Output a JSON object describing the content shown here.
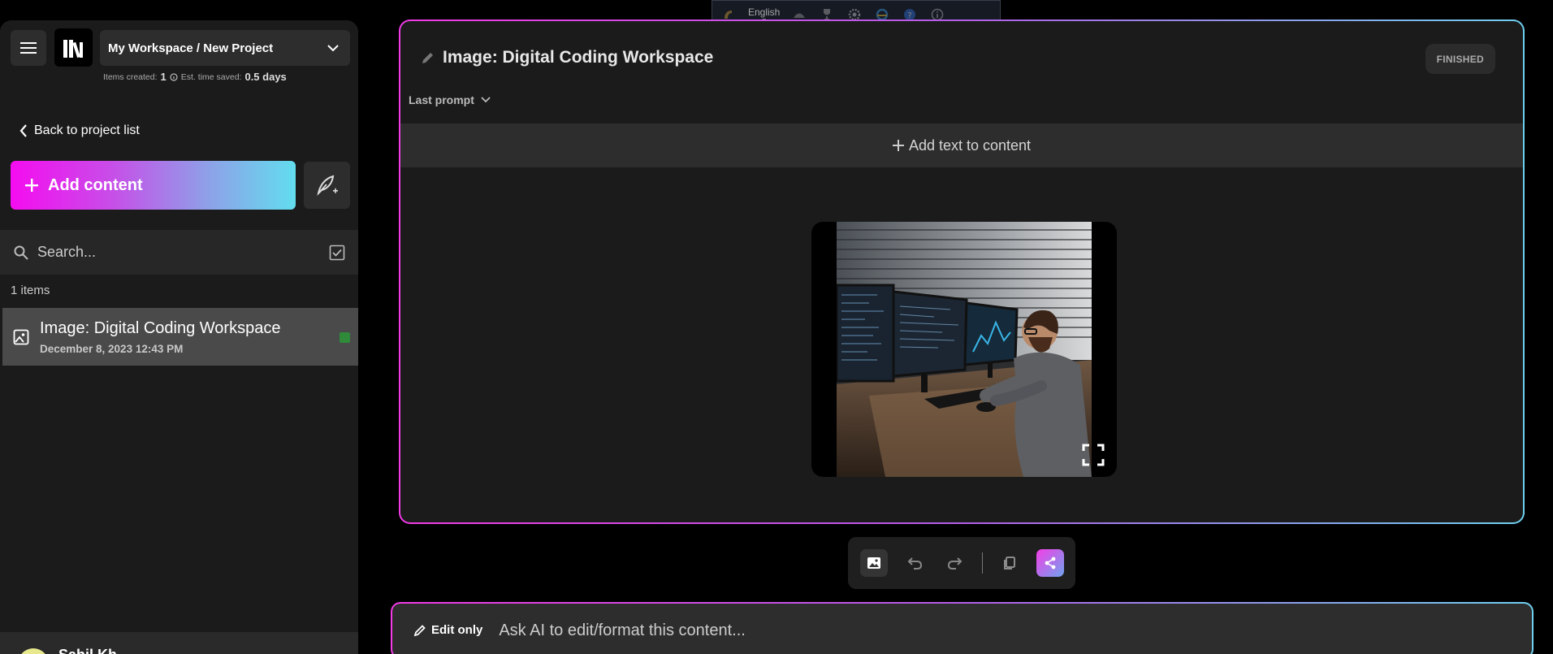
{
  "topbar": {
    "language": "English"
  },
  "sidebar": {
    "workspace_name": "My Workspace / New Project",
    "stats": {
      "items_created_label": "Items created:",
      "items_created_value": "1",
      "time_saved_label": "Est. time saved:",
      "time_saved_value": "0.5 days"
    },
    "back_label": "Back to project list",
    "add_content_label": "Add content",
    "search_placeholder": "Search...",
    "items_count": "1 items",
    "items": [
      {
        "title": "Image: Digital Coding Workspace",
        "date": "December 8, 2023 12:43 PM"
      }
    ],
    "user_name": "Sahil Kh"
  },
  "main": {
    "title": "Image: Digital Coding Workspace",
    "status": "FINISHED",
    "last_prompt_label": "Last prompt",
    "add_text_label": "Add text to content"
  },
  "ai_bar": {
    "mode_label": "Edit only",
    "placeholder": "Ask AI to edit/format this content..."
  }
}
